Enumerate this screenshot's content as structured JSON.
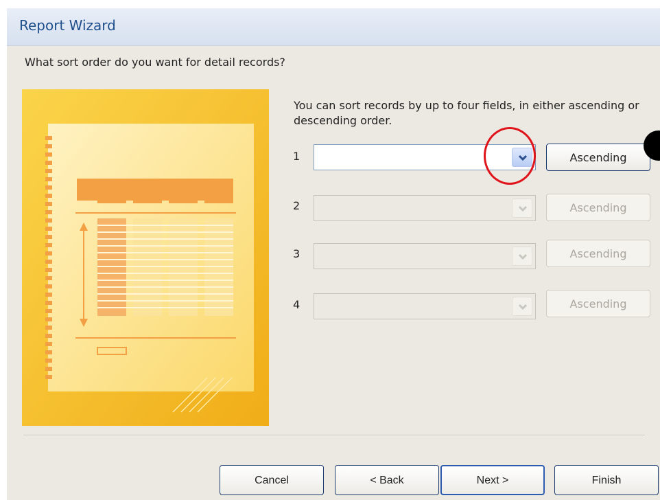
{
  "window": {
    "title": "Report Wizard",
    "question": "What sort order do you want for detail records?"
  },
  "instructions": "You can sort records by up to four fields, in either ascending or descending order.",
  "sort_rows": [
    {
      "number": "1",
      "field_value": "",
      "order_label": "Ascending",
      "enabled": true
    },
    {
      "number": "2",
      "field_value": "",
      "order_label": "Ascending",
      "enabled": false
    },
    {
      "number": "3",
      "field_value": "",
      "order_label": "Ascending",
      "enabled": false
    },
    {
      "number": "4",
      "field_value": "",
      "order_label": "Ascending",
      "enabled": false
    }
  ],
  "footer": {
    "cancel_label": "Cancel",
    "back_label": "< Back",
    "next_label": "Next >",
    "finish_label": "Finish"
  },
  "colors": {
    "title_text": "#1f4e8c",
    "illustration_bg": "#f6c21f",
    "illustration_accent": "#f2a043",
    "highlight_circle": "#e0141b"
  },
  "icons": {
    "dropdown": "chevron-down-icon",
    "illustration": "report-illustration"
  }
}
